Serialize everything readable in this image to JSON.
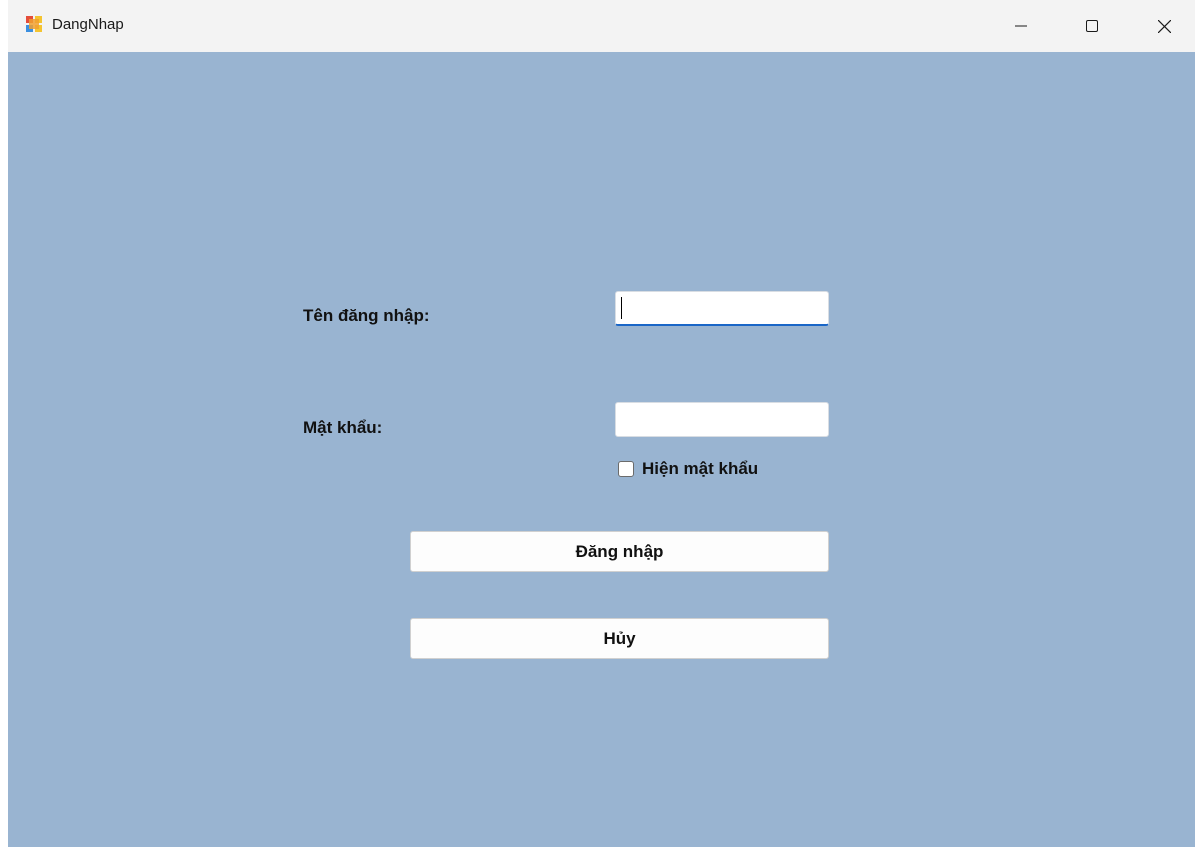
{
  "window": {
    "title": "DangNhap",
    "background_color": "#99b4d1",
    "icons": {
      "app": "windows-form-icon",
      "minimize": "minimize-icon",
      "maximize": "maximize-icon",
      "close": "close-icon"
    }
  },
  "form": {
    "username_label": "Tên đăng nhập:",
    "username_value": "",
    "password_label": "Mật khẩu:",
    "password_value": "",
    "show_password_label": "Hiện mật khẩu",
    "show_password_checked": false,
    "login_button": "Đăng nhập",
    "cancel_button": "Hủy"
  }
}
